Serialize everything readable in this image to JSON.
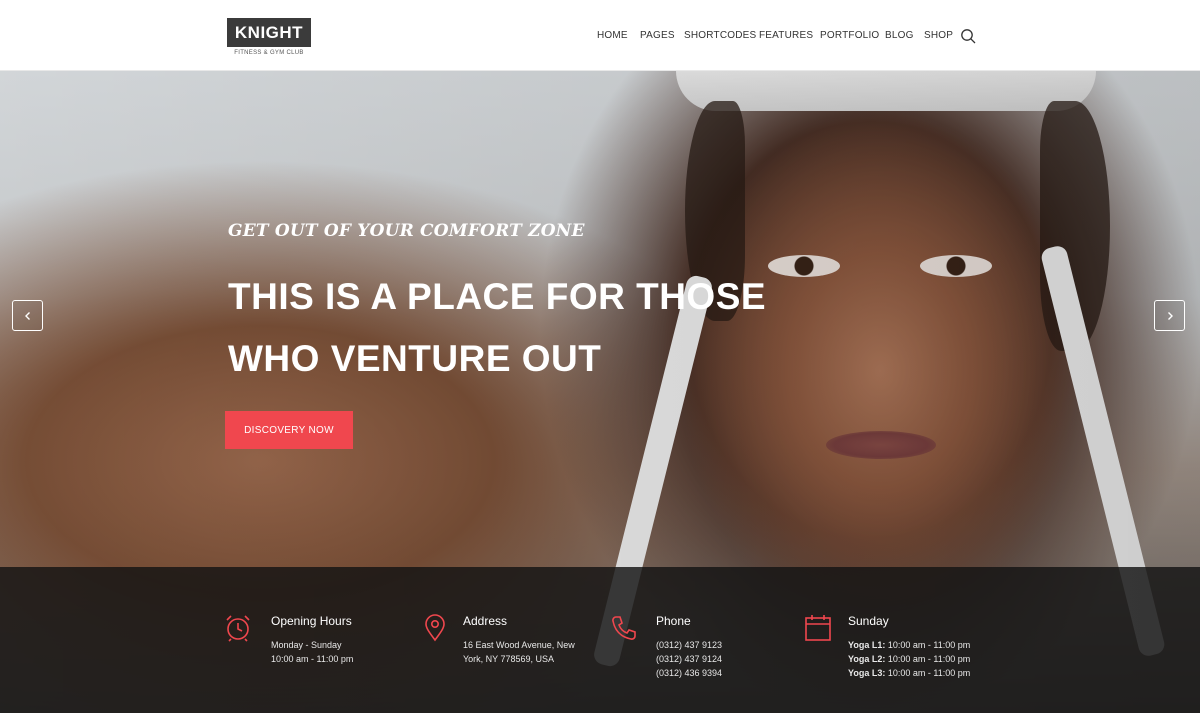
{
  "brand": {
    "name": "KNIGHT",
    "tagline": "FITNESS & GYM CLUB"
  },
  "nav": {
    "items": [
      "HOME",
      "PAGES",
      "SHORTCODES",
      "FEATURES",
      "PORTFOLIO",
      "BLOG",
      "SHOP"
    ],
    "search_icon": "search-icon"
  },
  "hero": {
    "kicker": "GET OUT OF YOUR COMFORT ZONE",
    "headline_line1": "THIS IS A PLACE FOR THOSE",
    "headline_line2": "WHO VENTURE OUT",
    "cta_label": "DISCOVERY NOW",
    "prev_icon": "chevron-left-icon",
    "next_icon": "chevron-right-icon"
  },
  "info": {
    "hours": {
      "icon": "alarm-clock-icon",
      "title": "Opening Hours",
      "lines": [
        "Monday - Sunday",
        "10:00 am - 11:00 pm"
      ]
    },
    "address": {
      "icon": "map-pin-icon",
      "title": "Address",
      "lines": [
        "16 East Wood Avenue, New",
        "York, NY 778569, USA"
      ]
    },
    "phone": {
      "icon": "phone-icon",
      "title": "Phone",
      "lines": [
        "(0312) 437 9123",
        "(0312) 437 9124",
        "(0312) 436 9394"
      ]
    },
    "schedule": {
      "icon": "calendar-icon",
      "title": "Sunday",
      "rows": [
        {
          "label": "Yoga L1:",
          "time": "10:00 am - 11:00 pm"
        },
        {
          "label": "Yoga L2:",
          "time": "10:00 am - 11:00 pm"
        },
        {
          "label": "Yoga L3:",
          "time": "10:00 am - 11:00 pm"
        }
      ]
    }
  },
  "colors": {
    "accent": "#f0474e",
    "dark": "#3b3b3b",
    "overlay": "#141414"
  }
}
